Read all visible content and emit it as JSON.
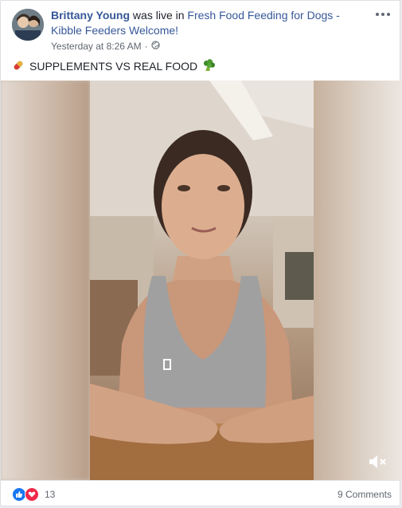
{
  "post": {
    "author": "Brittany Young",
    "action": " was live in ",
    "group": "Fresh Food Feeding for Dogs - Kibble Feeders Welcome!",
    "timestamp": "Yesterday at 8:26 AM",
    "separator": "·",
    "privacy_icon": "globe-icon",
    "text": "SUPPLEMENTS VS REAL FOOD",
    "leading_emoji": "pill-icon",
    "trailing_emoji": "broccoli-icon"
  },
  "video": {
    "mute_icon": "speaker-muted-icon"
  },
  "footer": {
    "reactions": [
      "like-icon",
      "love-icon"
    ],
    "reaction_count": "13",
    "comments": "9 Comments"
  },
  "colors": {
    "link": "#365899",
    "like": "#1877f2",
    "love": "#f0284a"
  }
}
